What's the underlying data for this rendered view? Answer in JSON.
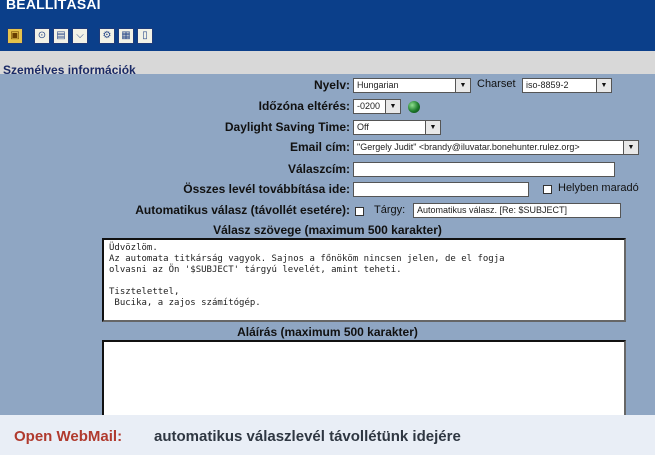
{
  "page": {
    "title": "BEÁLLÍTÁSAI"
  },
  "toolbar": {
    "buttons": [
      {
        "name": "toolbar-folder-button",
        "glyph": "▣",
        "gold": true
      },
      {
        "name": "toolbar-filter-button",
        "glyph": "⊙",
        "gold": false
      },
      {
        "name": "toolbar-copy-button",
        "glyph": "▤",
        "gold": false
      },
      {
        "name": "toolbar-funnel-button",
        "glyph": "⌵",
        "gold": false
      },
      {
        "name": "toolbar-settings-button",
        "glyph": "⚙",
        "gold": false
      },
      {
        "name": "toolbar-calendar-button",
        "glyph": "▦",
        "gold": false
      },
      {
        "name": "toolbar-info-button",
        "glyph": "▯",
        "gold": false
      }
    ]
  },
  "section": {
    "label": "Személyes információk"
  },
  "form": {
    "language_label": "Nyelv:",
    "language_value": "Hungarian",
    "charset_label": "Charset",
    "charset_value": "iso-8859-2",
    "timezone_label": "Időzóna eltérés:",
    "timezone_value": "-0200",
    "dst_label": "Daylight Saving Time:",
    "dst_value": "Off",
    "email_label": "Email cím:",
    "email_value": "\"Gergely Judit\" <brandy@iluvatar.bonehunter.rulez.org>",
    "reply_to_label": "Válaszcím:",
    "reply_to_value": "",
    "forward_label": "Összes levél továbbítása ide:",
    "forward_value": "",
    "keep_local_label": "Helyben maradó",
    "autoreply_label": "Automatikus válasz (távollét esetére):",
    "subject_label": "Tárgy:",
    "subject_value": "Automatikus válasz. [Re: $SUBJECT]",
    "reply_text_label": "Válasz szövege (maximum 500 karakter)",
    "reply_text_lines": [
      "Üdvözlöm.",
      "Az automata titkárság vagyok. Sajnos a főnököm nincsen jelen, de el fogja",
      "olvasni az Ön '$SUBJECT' tárgyú levelét, amint teheti.",
      "",
      "Tisztelettel,",
      " Bucika, a zajos számítógép."
    ],
    "signature_label": "Aláírás (maximum 500 karakter)"
  },
  "caption": {
    "brand": "Open WebMail:",
    "description": "automatikus válaszlevél távollétünk idejére"
  }
}
